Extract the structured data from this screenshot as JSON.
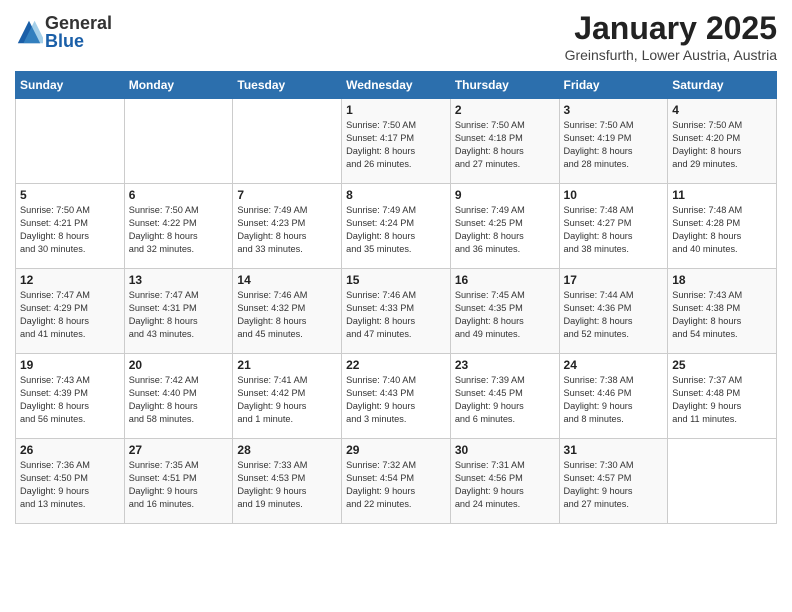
{
  "logo": {
    "general": "General",
    "blue": "Blue"
  },
  "header": {
    "month": "January 2025",
    "location": "Greinsfurth, Lower Austria, Austria"
  },
  "days_of_week": [
    "Sunday",
    "Monday",
    "Tuesday",
    "Wednesday",
    "Thursday",
    "Friday",
    "Saturday"
  ],
  "weeks": [
    [
      {
        "day": "",
        "info": ""
      },
      {
        "day": "",
        "info": ""
      },
      {
        "day": "",
        "info": ""
      },
      {
        "day": "1",
        "info": "Sunrise: 7:50 AM\nSunset: 4:17 PM\nDaylight: 8 hours\nand 26 minutes."
      },
      {
        "day": "2",
        "info": "Sunrise: 7:50 AM\nSunset: 4:18 PM\nDaylight: 8 hours\nand 27 minutes."
      },
      {
        "day": "3",
        "info": "Sunrise: 7:50 AM\nSunset: 4:19 PM\nDaylight: 8 hours\nand 28 minutes."
      },
      {
        "day": "4",
        "info": "Sunrise: 7:50 AM\nSunset: 4:20 PM\nDaylight: 8 hours\nand 29 minutes."
      }
    ],
    [
      {
        "day": "5",
        "info": "Sunrise: 7:50 AM\nSunset: 4:21 PM\nDaylight: 8 hours\nand 30 minutes."
      },
      {
        "day": "6",
        "info": "Sunrise: 7:50 AM\nSunset: 4:22 PM\nDaylight: 8 hours\nand 32 minutes."
      },
      {
        "day": "7",
        "info": "Sunrise: 7:49 AM\nSunset: 4:23 PM\nDaylight: 8 hours\nand 33 minutes."
      },
      {
        "day": "8",
        "info": "Sunrise: 7:49 AM\nSunset: 4:24 PM\nDaylight: 8 hours\nand 35 minutes."
      },
      {
        "day": "9",
        "info": "Sunrise: 7:49 AM\nSunset: 4:25 PM\nDaylight: 8 hours\nand 36 minutes."
      },
      {
        "day": "10",
        "info": "Sunrise: 7:48 AM\nSunset: 4:27 PM\nDaylight: 8 hours\nand 38 minutes."
      },
      {
        "day": "11",
        "info": "Sunrise: 7:48 AM\nSunset: 4:28 PM\nDaylight: 8 hours\nand 40 minutes."
      }
    ],
    [
      {
        "day": "12",
        "info": "Sunrise: 7:47 AM\nSunset: 4:29 PM\nDaylight: 8 hours\nand 41 minutes."
      },
      {
        "day": "13",
        "info": "Sunrise: 7:47 AM\nSunset: 4:31 PM\nDaylight: 8 hours\nand 43 minutes."
      },
      {
        "day": "14",
        "info": "Sunrise: 7:46 AM\nSunset: 4:32 PM\nDaylight: 8 hours\nand 45 minutes."
      },
      {
        "day": "15",
        "info": "Sunrise: 7:46 AM\nSunset: 4:33 PM\nDaylight: 8 hours\nand 47 minutes."
      },
      {
        "day": "16",
        "info": "Sunrise: 7:45 AM\nSunset: 4:35 PM\nDaylight: 8 hours\nand 49 minutes."
      },
      {
        "day": "17",
        "info": "Sunrise: 7:44 AM\nSunset: 4:36 PM\nDaylight: 8 hours\nand 52 minutes."
      },
      {
        "day": "18",
        "info": "Sunrise: 7:43 AM\nSunset: 4:38 PM\nDaylight: 8 hours\nand 54 minutes."
      }
    ],
    [
      {
        "day": "19",
        "info": "Sunrise: 7:43 AM\nSunset: 4:39 PM\nDaylight: 8 hours\nand 56 minutes."
      },
      {
        "day": "20",
        "info": "Sunrise: 7:42 AM\nSunset: 4:40 PM\nDaylight: 8 hours\nand 58 minutes."
      },
      {
        "day": "21",
        "info": "Sunrise: 7:41 AM\nSunset: 4:42 PM\nDaylight: 9 hours\nand 1 minute."
      },
      {
        "day": "22",
        "info": "Sunrise: 7:40 AM\nSunset: 4:43 PM\nDaylight: 9 hours\nand 3 minutes."
      },
      {
        "day": "23",
        "info": "Sunrise: 7:39 AM\nSunset: 4:45 PM\nDaylight: 9 hours\nand 6 minutes."
      },
      {
        "day": "24",
        "info": "Sunrise: 7:38 AM\nSunset: 4:46 PM\nDaylight: 9 hours\nand 8 minutes."
      },
      {
        "day": "25",
        "info": "Sunrise: 7:37 AM\nSunset: 4:48 PM\nDaylight: 9 hours\nand 11 minutes."
      }
    ],
    [
      {
        "day": "26",
        "info": "Sunrise: 7:36 AM\nSunset: 4:50 PM\nDaylight: 9 hours\nand 13 minutes."
      },
      {
        "day": "27",
        "info": "Sunrise: 7:35 AM\nSunset: 4:51 PM\nDaylight: 9 hours\nand 16 minutes."
      },
      {
        "day": "28",
        "info": "Sunrise: 7:33 AM\nSunset: 4:53 PM\nDaylight: 9 hours\nand 19 minutes."
      },
      {
        "day": "29",
        "info": "Sunrise: 7:32 AM\nSunset: 4:54 PM\nDaylight: 9 hours\nand 22 minutes."
      },
      {
        "day": "30",
        "info": "Sunrise: 7:31 AM\nSunset: 4:56 PM\nDaylight: 9 hours\nand 24 minutes."
      },
      {
        "day": "31",
        "info": "Sunrise: 7:30 AM\nSunset: 4:57 PM\nDaylight: 9 hours\nand 27 minutes."
      },
      {
        "day": "",
        "info": ""
      }
    ]
  ]
}
